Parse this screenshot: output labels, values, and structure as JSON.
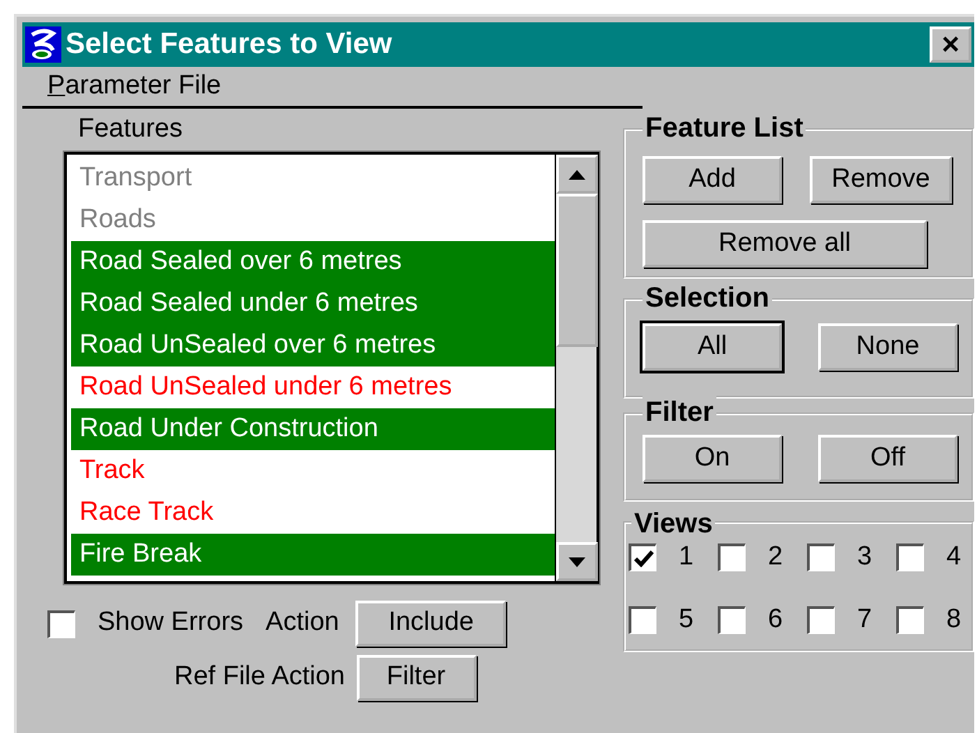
{
  "window": {
    "title": "Select Features to View",
    "close": "×"
  },
  "menu": [
    {
      "label": "Parameter File",
      "mnemonic_underlined": true
    }
  ],
  "features": {
    "label": "Features",
    "items": [
      {
        "label": "Transport",
        "selected": false,
        "color": "#808080"
      },
      {
        "label": "Roads",
        "selected": false,
        "color": "#808080"
      },
      {
        "label": "Road Sealed over 6 metres",
        "selected": true
      },
      {
        "label": "Road Sealed under 6 metres",
        "selected": true
      },
      {
        "label": "Road UnSealed over 6 metres",
        "selected": true
      },
      {
        "label": "Road UnSealed under 6 metres",
        "selected": false,
        "color": "#ff0000"
      },
      {
        "label": "Road Under Construction",
        "selected": true
      },
      {
        "label": "Track",
        "selected": false,
        "color": "#ff0000"
      },
      {
        "label": "Race Track",
        "selected": false,
        "color": "#ff0000"
      },
      {
        "label": "Fire Break",
        "selected": true
      }
    ]
  },
  "show_errors": {
    "label": "Show Errors",
    "checked": false
  },
  "action": {
    "label": "Action",
    "button": "Include"
  },
  "ref_file_action": {
    "label": "Ref File Action",
    "button": "Filter"
  },
  "feature_list": {
    "title": "Feature List",
    "buttons": [
      "Add",
      "Remove",
      "Remove all"
    ]
  },
  "selection": {
    "title": "Selection",
    "buttons": [
      {
        "label": "All",
        "default": true
      },
      {
        "label": "None",
        "default": false
      }
    ]
  },
  "filter": {
    "title": "Filter",
    "buttons": [
      "On",
      "Off"
    ]
  },
  "views": {
    "title": "Views",
    "items": [
      {
        "label": "1",
        "checked": true
      },
      {
        "label": "2",
        "checked": false
      },
      {
        "label": "3",
        "checked": false
      },
      {
        "label": "4",
        "checked": false
      },
      {
        "label": "5",
        "checked": false
      },
      {
        "label": "6",
        "checked": false
      },
      {
        "label": "7",
        "checked": false
      },
      {
        "label": "8",
        "checked": false
      }
    ]
  }
}
